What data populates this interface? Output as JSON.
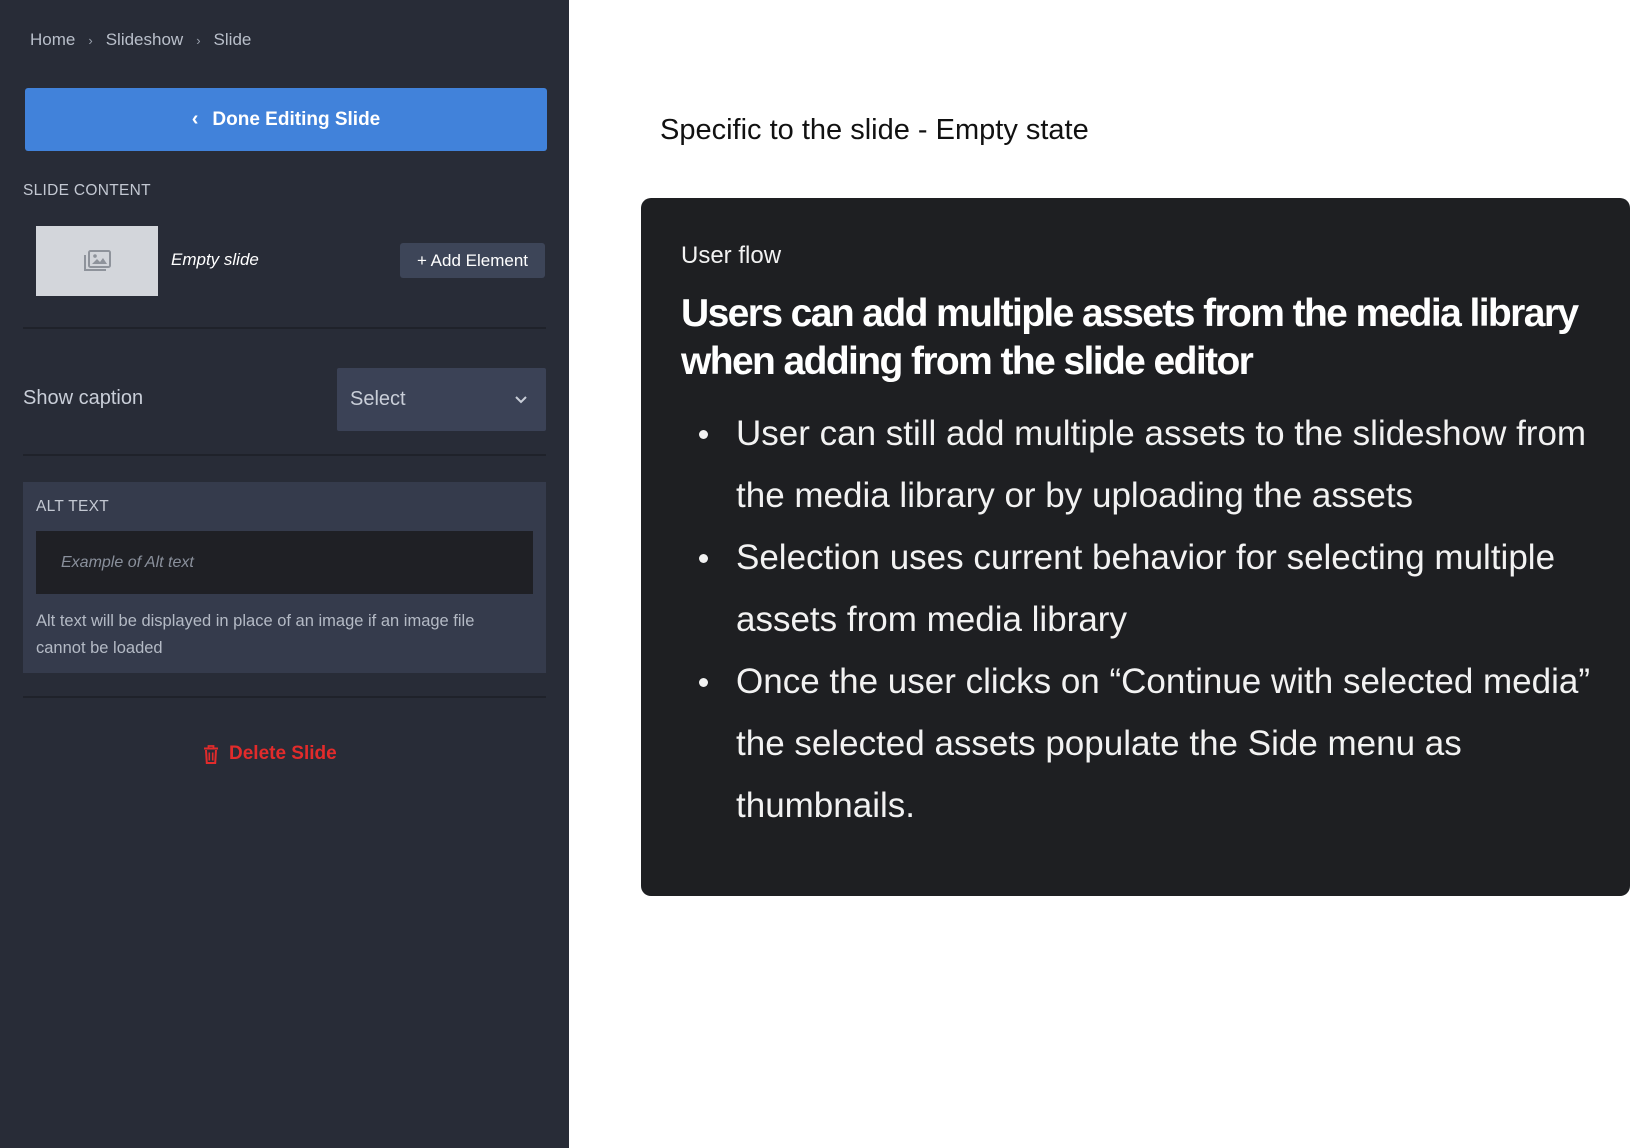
{
  "breadcrumb": {
    "items": [
      "Home",
      "Slideshow",
      "Slide"
    ],
    "separator": "›"
  },
  "sidebar": {
    "done_button_label": "Done Editing Slide",
    "slide_content_title": "SLIDE CONTENT",
    "thumbnail_icon": "image-gallery-icon",
    "empty_slide_label": "Empty slide",
    "add_element_label": "+ Add Element",
    "show_caption_label": "Show caption",
    "caption_select": {
      "selected": "Select",
      "icon": "chevron-down-icon"
    },
    "alt_text": {
      "title": "ALT TEXT",
      "placeholder": "Example of Alt text",
      "help": "Alt text will be displayed in place of an image if an image file cannot be loaded"
    },
    "delete_label": "Delete Slide",
    "delete_icon": "trash-icon"
  },
  "content": {
    "heading": "Specific to the slide - Empty state",
    "card": {
      "label": "User flow",
      "title": "Users can add multiple assets from the media library when adding from the slide editor",
      "bullets": [
        "User can still add multiple  assets to the slideshow from the media library or by uploading the assets",
        "Selection uses current behavior for selecting multiple assets from media library",
        "Once the user clicks on “Continue with selected media” the selected assets populate the Side menu as thumbnails."
      ]
    }
  },
  "colors": {
    "panel_bg": "#282c37",
    "primary_button": "#4182da",
    "danger": "#e22b2b",
    "card_bg": "#1e1f22"
  }
}
